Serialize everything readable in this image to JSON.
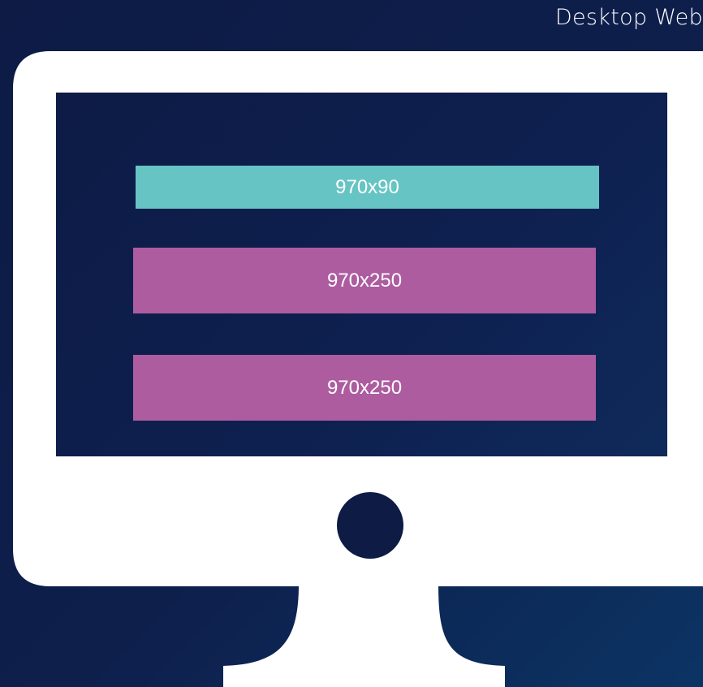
{
  "title": "Desktop Web",
  "colors": {
    "background": "#0e1f4c",
    "monitor": "#ffffff",
    "leaderboard": "#66c4c4",
    "billboard": "#ad5ca0"
  },
  "ad_slots": [
    {
      "label": "970x90",
      "color": "#66c4c4"
    },
    {
      "label": "970x250",
      "color": "#ad5ca0"
    },
    {
      "label": "970x250",
      "color": "#ad5ca0"
    }
  ]
}
